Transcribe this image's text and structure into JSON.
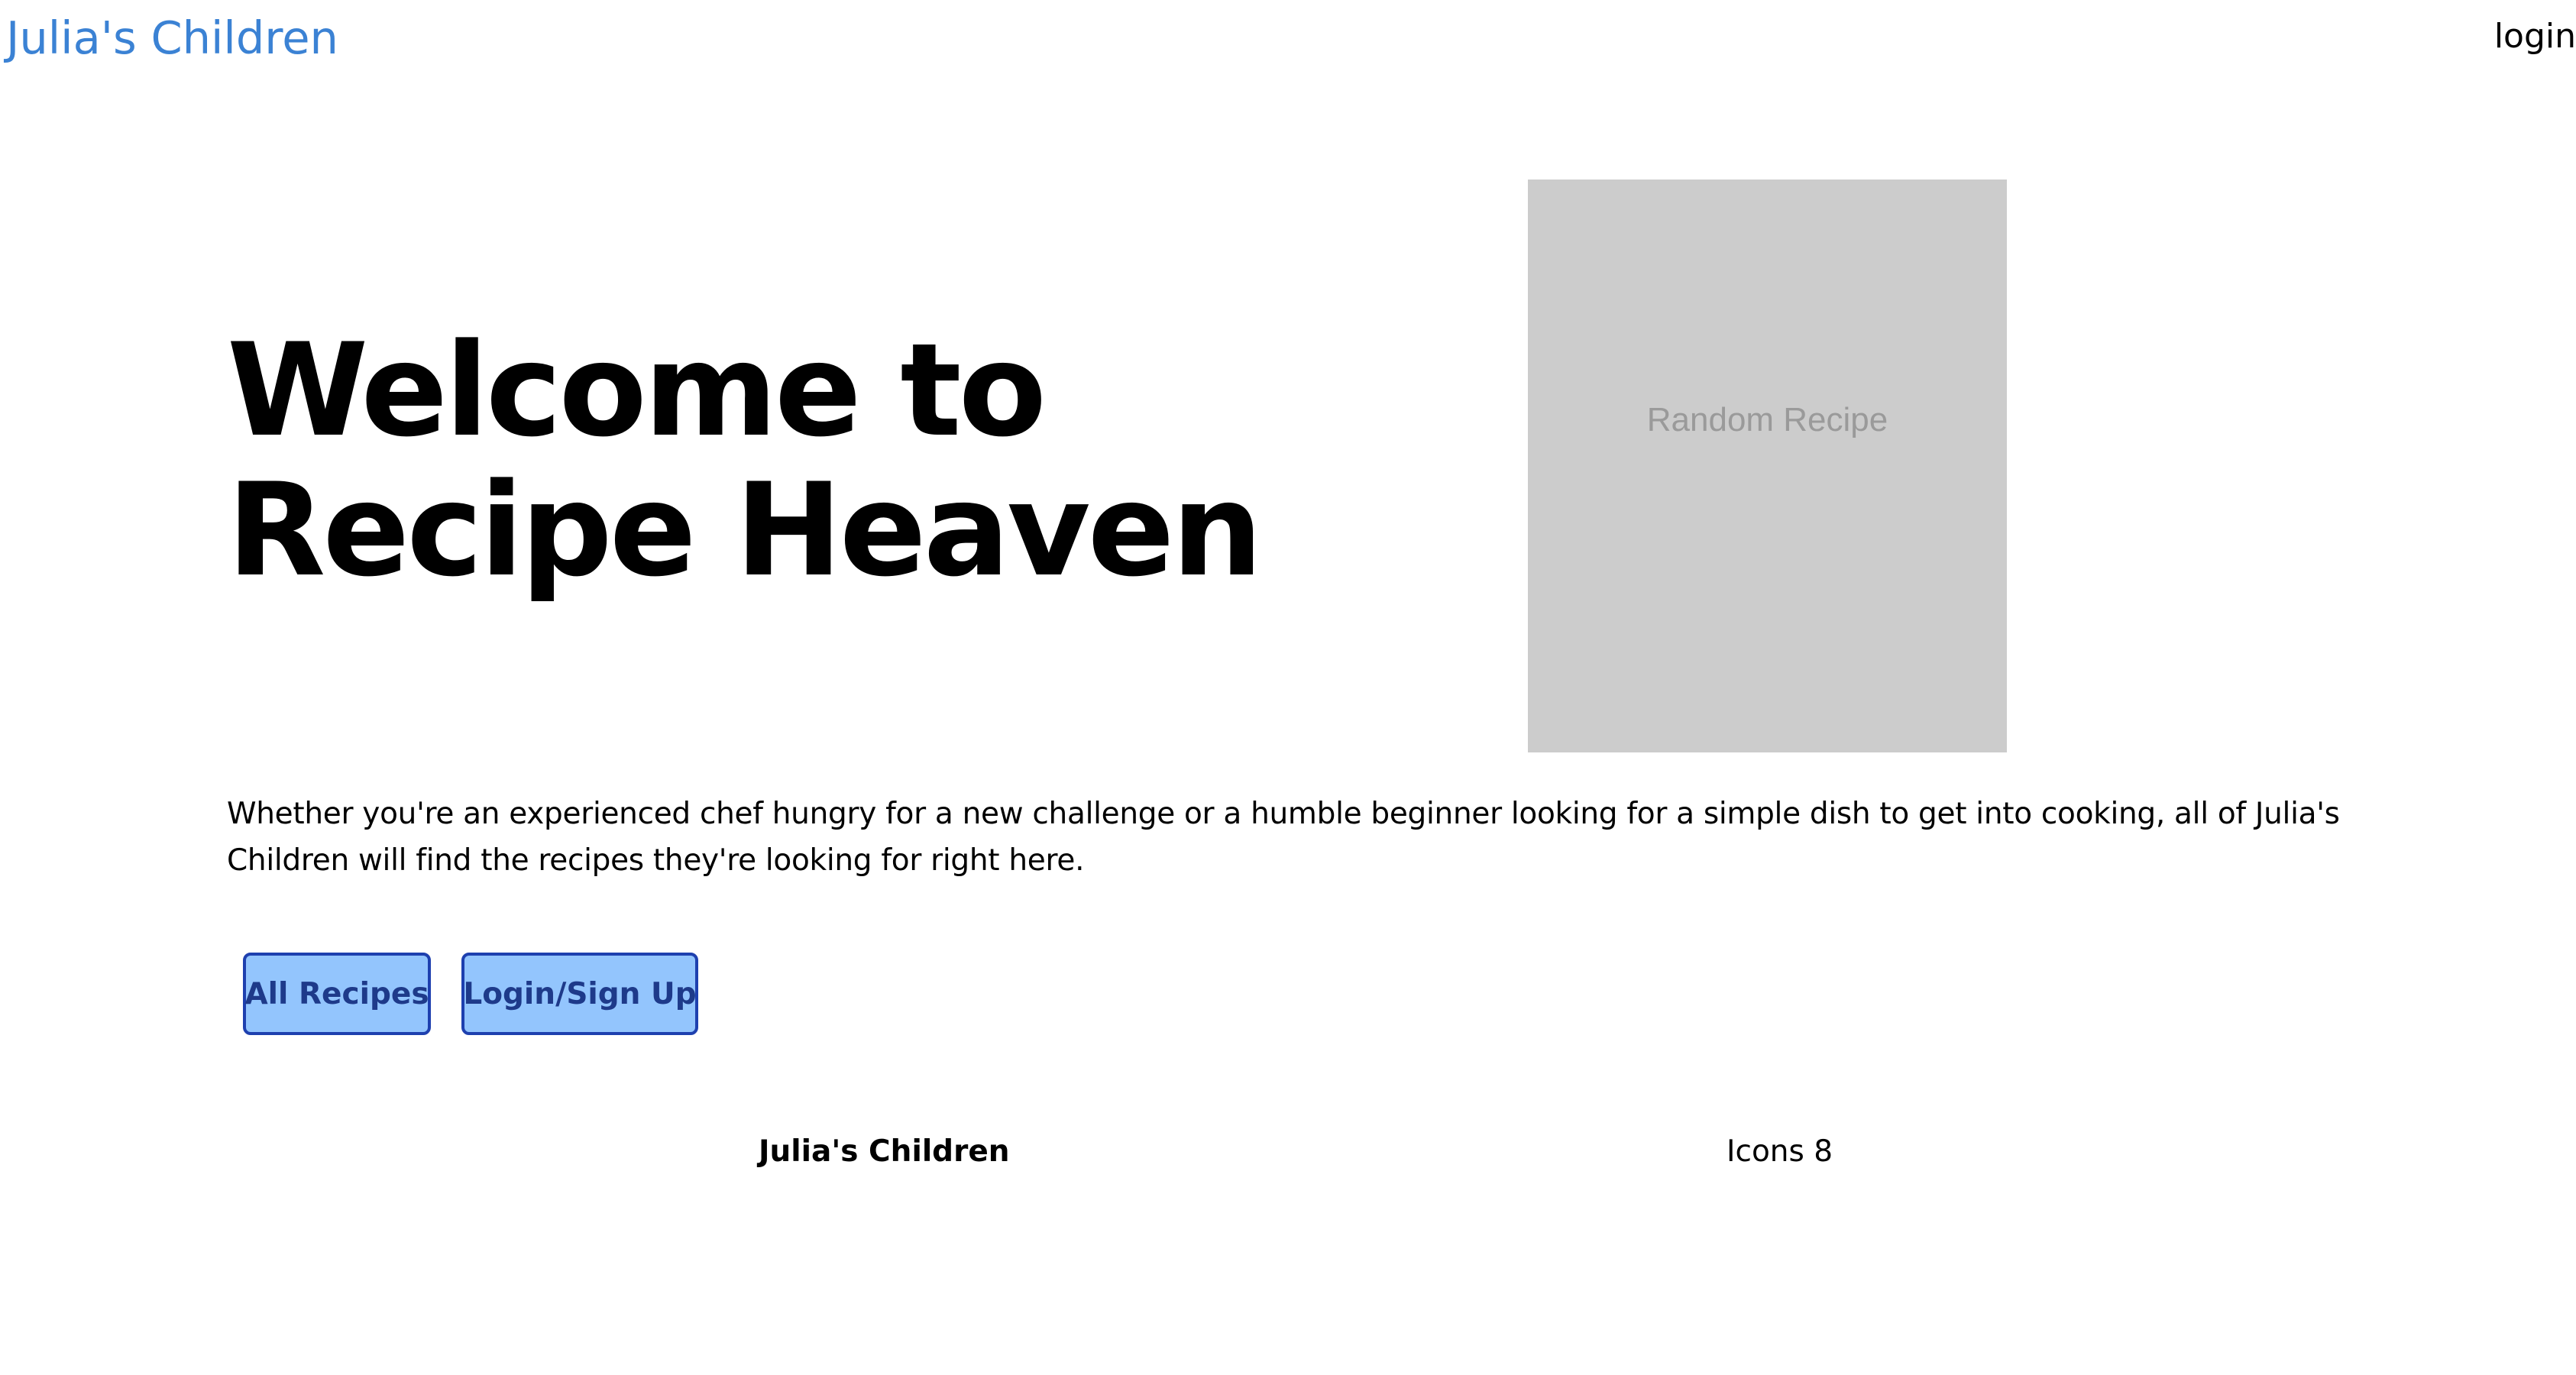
{
  "header": {
    "brand": "Julia's Children",
    "login_link": "login"
  },
  "hero": {
    "title_line1": "Welcome to",
    "title_line2": "Recipe Heaven",
    "random_recipe_label": "Random Recipe",
    "intro": "Whether you're an experienced chef hungry for a new challenge or a humble beginner looking for a simple dish to get into cooking, all of Julia's Children will find the recipes they're looking for right here."
  },
  "actions": {
    "all_recipes": "All Recipes",
    "login_signup": "Login/Sign Up"
  },
  "footer": {
    "brand": "Julia's Children",
    "icons_credit": "Icons 8"
  },
  "colors": {
    "brand": "#3b82d4",
    "button_fill": "#93c5fd",
    "button_border": "#1e40af",
    "placeholder": "#cccccc"
  }
}
